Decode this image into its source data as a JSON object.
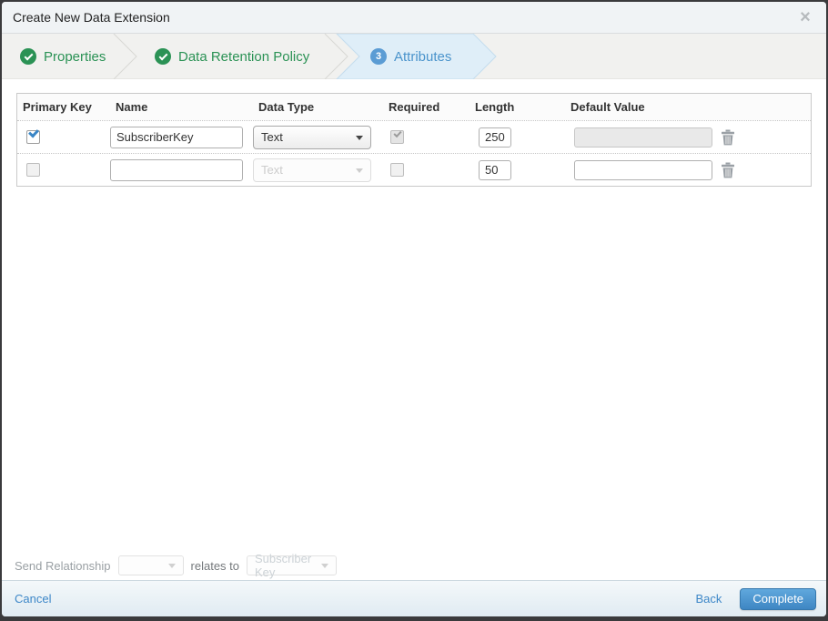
{
  "dialog": {
    "title": "Create New Data Extension"
  },
  "icons": {
    "close": "×"
  },
  "colors": {
    "step_complete_green": "#2b9255",
    "step_active_blue": "#4b94cc",
    "active_step_bg": "#dfeef8",
    "primary_button_blue": "#3e86c3",
    "link_blue": "#3d87c8"
  },
  "wizard": {
    "steps": [
      {
        "label": "Properties",
        "state": "complete"
      },
      {
        "label": "Data Retention Policy",
        "state": "complete"
      },
      {
        "label": "Attributes",
        "state": "active",
        "number": "3"
      }
    ]
  },
  "attributes_table": {
    "headers": {
      "primary_key": "Primary Key",
      "name": "Name",
      "data_type": "Data Type",
      "required": "Required",
      "length": "Length",
      "default_value": "Default Value"
    },
    "rows": [
      {
        "primary_key_checked": true,
        "name_value": "SubscriberKey",
        "data_type": "Text",
        "data_type_disabled": false,
        "required_checked": true,
        "required_disabled": true,
        "length_value": "250",
        "default_value": "",
        "default_disabled": true
      },
      {
        "primary_key_checked": false,
        "name_value": "",
        "data_type": "Text",
        "data_type_disabled": true,
        "required_checked": false,
        "required_disabled": false,
        "length_value": "50",
        "default_value": "",
        "default_disabled": false
      }
    ]
  },
  "send_relationship": {
    "label": "Send Relationship",
    "relates_to": "relates to",
    "target_field": "Subscriber Key"
  },
  "footer": {
    "cancel": "Cancel",
    "back": "Back",
    "complete": "Complete"
  }
}
